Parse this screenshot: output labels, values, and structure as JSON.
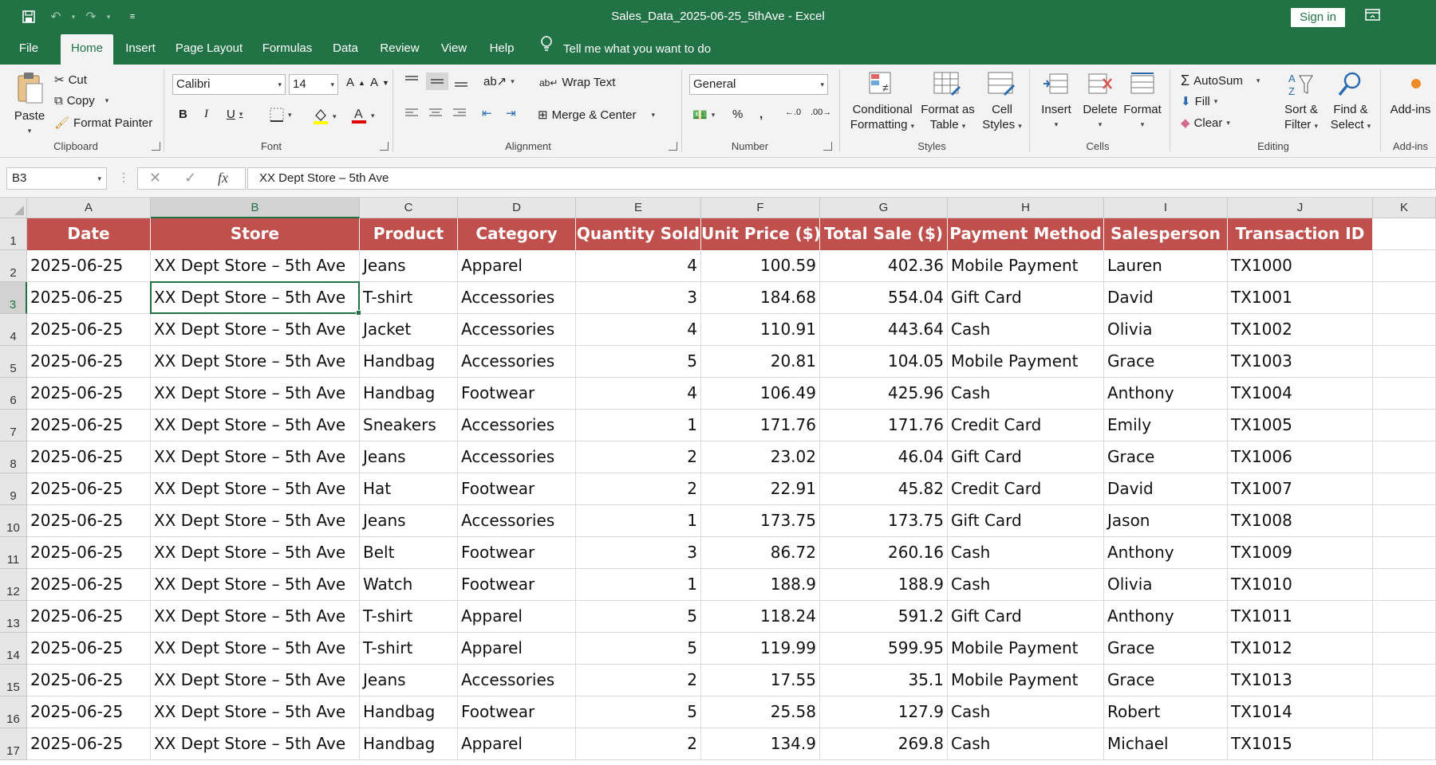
{
  "window": {
    "title": "Sales_Data_2025-06-25_5thAve  -  Excel",
    "sign_in": "Sign in"
  },
  "tabs": [
    {
      "label": "File"
    },
    {
      "label": "Home"
    },
    {
      "label": "Insert"
    },
    {
      "label": "Page Layout"
    },
    {
      "label": "Formulas"
    },
    {
      "label": "Data"
    },
    {
      "label": "Review"
    },
    {
      "label": "View"
    },
    {
      "label": "Help"
    }
  ],
  "tell_me": "Tell me what you want to do",
  "ribbon": {
    "clipboard": {
      "paste": "Paste",
      "cut": "Cut",
      "copy": "Copy",
      "format_painter": "Format Painter",
      "label": "Clipboard"
    },
    "font": {
      "name": "Calibri",
      "size": "14",
      "label": "Font"
    },
    "alignment": {
      "wrap_text": "Wrap Text",
      "merge_center": "Merge & Center",
      "label": "Alignment"
    },
    "number": {
      "format": "General",
      "label": "Number"
    },
    "styles": {
      "conditional_1": "Conditional",
      "conditional_2": "Formatting",
      "format_table_1": "Format as",
      "format_table_2": "Table",
      "cell_styles_1": "Cell",
      "cell_styles_2": "Styles",
      "label": "Styles"
    },
    "cells": {
      "insert": "Insert",
      "delete": "Delete",
      "format": "Format",
      "label": "Cells"
    },
    "editing": {
      "autosum": "AutoSum",
      "fill": "Fill",
      "clear": "Clear",
      "sort_1": "Sort &",
      "sort_2": "Filter",
      "find_1": "Find &",
      "find_2": "Select",
      "label": "Editing"
    },
    "addins": {
      "button": "Add-ins",
      "label": "Add-ins"
    }
  },
  "formula_bar": {
    "name_box": "B3",
    "formula": "XX Dept Store – 5th Ave"
  },
  "sheet": {
    "column_letters": [
      "A",
      "B",
      "C",
      "D",
      "E",
      "F",
      "G",
      "H",
      "I",
      "J",
      "K"
    ],
    "row_numbers": [
      "1",
      "2",
      "3",
      "4",
      "5",
      "6",
      "7",
      "8",
      "9",
      "10",
      "11",
      "12",
      "13",
      "14",
      "15",
      "16",
      "17"
    ],
    "headers": [
      "Date",
      "Store",
      "Product",
      "Category",
      "Quantity Sold",
      "Unit Price ($)",
      "Total Sale ($)",
      "Payment Method",
      "Salesperson",
      "Transaction ID"
    ],
    "rows": [
      [
        "2025-06-25",
        "XX Dept Store – 5th Ave",
        "Jeans",
        "Apparel",
        "4",
        "100.59",
        "402.36",
        "Mobile Payment",
        "Lauren",
        "TX1000"
      ],
      [
        "2025-06-25",
        "XX Dept Store – 5th Ave",
        "T-shirt",
        "Accessories",
        "3",
        "184.68",
        "554.04",
        "Gift Card",
        "David",
        "TX1001"
      ],
      [
        "2025-06-25",
        "XX Dept Store – 5th Ave",
        "Jacket",
        "Accessories",
        "4",
        "110.91",
        "443.64",
        "Cash",
        "Olivia",
        "TX1002"
      ],
      [
        "2025-06-25",
        "XX Dept Store – 5th Ave",
        "Handbag",
        "Accessories",
        "5",
        "20.81",
        "104.05",
        "Mobile Payment",
        "Grace",
        "TX1003"
      ],
      [
        "2025-06-25",
        "XX Dept Store – 5th Ave",
        "Handbag",
        "Footwear",
        "4",
        "106.49",
        "425.96",
        "Cash",
        "Anthony",
        "TX1004"
      ],
      [
        "2025-06-25",
        "XX Dept Store – 5th Ave",
        "Sneakers",
        "Accessories",
        "1",
        "171.76",
        "171.76",
        "Credit Card",
        "Emily",
        "TX1005"
      ],
      [
        "2025-06-25",
        "XX Dept Store – 5th Ave",
        "Jeans",
        "Accessories",
        "2",
        "23.02",
        "46.04",
        "Gift Card",
        "Grace",
        "TX1006"
      ],
      [
        "2025-06-25",
        "XX Dept Store – 5th Ave",
        "Hat",
        "Footwear",
        "2",
        "22.91",
        "45.82",
        "Credit Card",
        "David",
        "TX1007"
      ],
      [
        "2025-06-25",
        "XX Dept Store – 5th Ave",
        "Jeans",
        "Accessories",
        "1",
        "173.75",
        "173.75",
        "Gift Card",
        "Jason",
        "TX1008"
      ],
      [
        "2025-06-25",
        "XX Dept Store – 5th Ave",
        "Belt",
        "Footwear",
        "3",
        "86.72",
        "260.16",
        "Cash",
        "Anthony",
        "TX1009"
      ],
      [
        "2025-06-25",
        "XX Dept Store – 5th Ave",
        "Watch",
        "Footwear",
        "1",
        "188.9",
        "188.9",
        "Cash",
        "Olivia",
        "TX1010"
      ],
      [
        "2025-06-25",
        "XX Dept Store – 5th Ave",
        "T-shirt",
        "Apparel",
        "5",
        "118.24",
        "591.2",
        "Gift Card",
        "Anthony",
        "TX1011"
      ],
      [
        "2025-06-25",
        "XX Dept Store – 5th Ave",
        "T-shirt",
        "Apparel",
        "5",
        "119.99",
        "599.95",
        "Mobile Payment",
        "Grace",
        "TX1012"
      ],
      [
        "2025-06-25",
        "XX Dept Store – 5th Ave",
        "Jeans",
        "Accessories",
        "2",
        "17.55",
        "35.1",
        "Mobile Payment",
        "Grace",
        "TX1013"
      ],
      [
        "2025-06-25",
        "XX Dept Store – 5th Ave",
        "Handbag",
        "Footwear",
        "5",
        "25.58",
        "127.9",
        "Cash",
        "Robert",
        "TX1014"
      ],
      [
        "2025-06-25",
        "XX Dept Store – 5th Ave",
        "Handbag",
        "Apparel",
        "2",
        "134.9",
        "269.8",
        "Cash",
        "Michael",
        "TX1015"
      ]
    ],
    "numeric_columns": [
      4,
      5,
      6
    ],
    "selected_cell": {
      "row": 3,
      "col": "B"
    }
  },
  "colors": {
    "excel_green": "#217346",
    "header_fill": "#c0504d"
  }
}
